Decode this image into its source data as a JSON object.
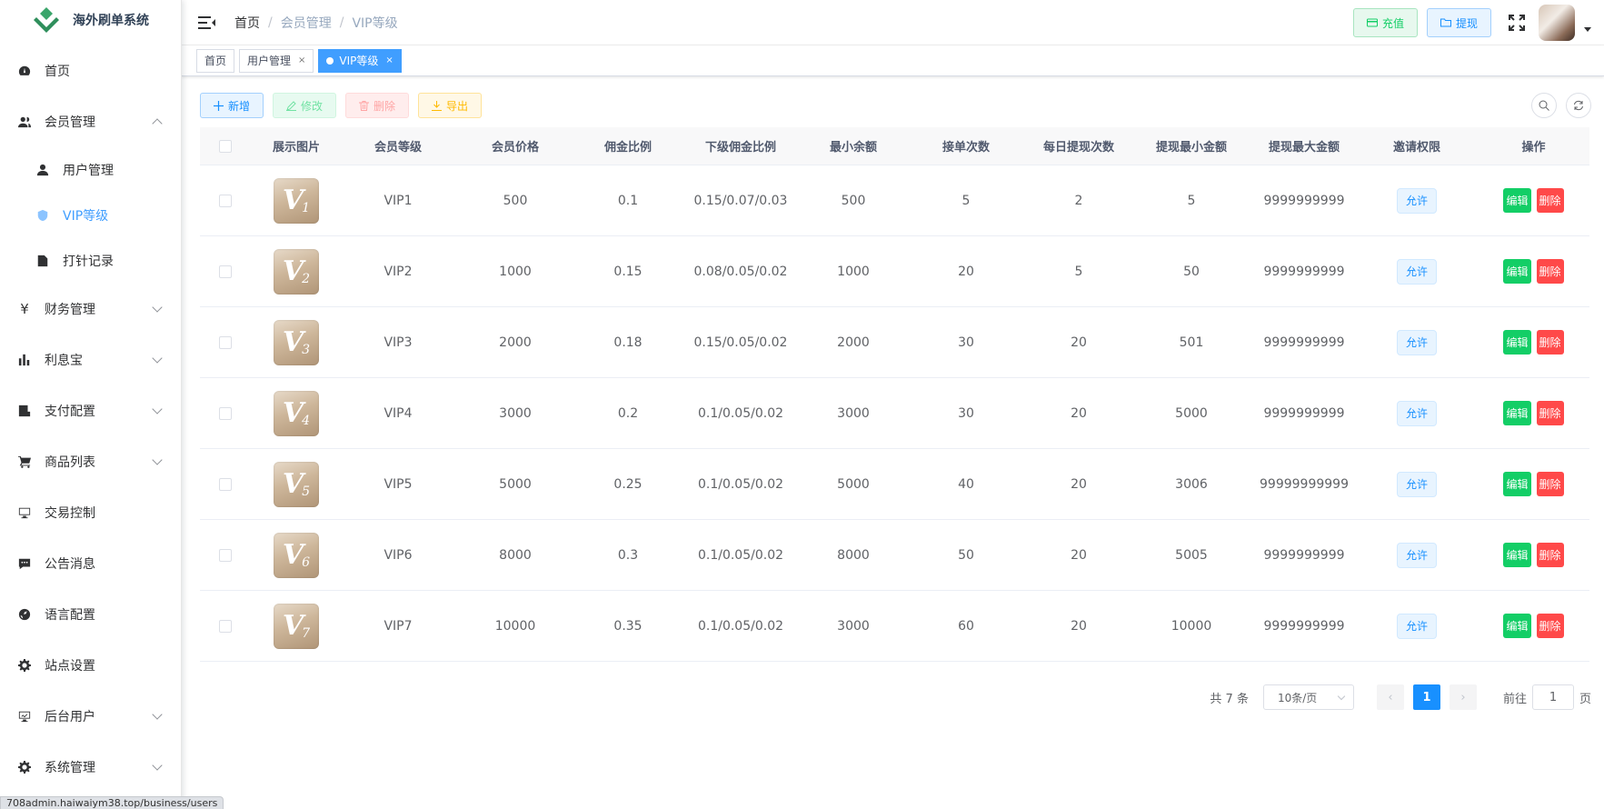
{
  "app": {
    "title": "海外刷单系统"
  },
  "sidebar": {
    "items": [
      {
        "label": "首页",
        "icon": "dashboard-icon"
      },
      {
        "label": "会员管理",
        "icon": "user-group-icon",
        "expanded": true,
        "children": [
          {
            "label": "用户管理",
            "icon": "user-icon"
          },
          {
            "label": "VIP等级",
            "icon": "shield-icon",
            "active": true
          },
          {
            "label": "打针记录",
            "icon": "document-icon"
          }
        ]
      },
      {
        "label": "财务管理",
        "icon": "yen-icon",
        "collapsible": true
      },
      {
        "label": "利息宝",
        "icon": "bar-chart-icon",
        "collapsible": true
      },
      {
        "label": "支付配置",
        "icon": "pay-config-icon",
        "collapsible": true
      },
      {
        "label": "商品列表",
        "icon": "cart-icon",
        "collapsible": true
      },
      {
        "label": "交易控制",
        "icon": "monitor-icon"
      },
      {
        "label": "公告消息",
        "icon": "message-icon"
      },
      {
        "label": "语言配置",
        "icon": "globe-icon"
      },
      {
        "label": "站点设置",
        "icon": "gear-icon"
      },
      {
        "label": "后台用户",
        "icon": "admin-monitor-icon",
        "collapsible": true
      },
      {
        "label": "系统管理",
        "icon": "settings-icon",
        "collapsible": true
      }
    ]
  },
  "header": {
    "breadcrumb": [
      "首页",
      "会员管理",
      "VIP等级"
    ],
    "recharge_label": "充值",
    "withdraw_label": "提现"
  },
  "tags": [
    {
      "label": "首页",
      "closable": false
    },
    {
      "label": "用户管理",
      "closable": true
    },
    {
      "label": "VIP等级",
      "closable": true,
      "active": true
    }
  ],
  "toolbar": {
    "add_label": "新增",
    "edit_label": "修改",
    "delete_label": "删除",
    "export_label": "导出"
  },
  "table": {
    "headers": [
      "展示图片",
      "会员等级",
      "会员价格",
      "佣金比例",
      "下级佣金比例",
      "最小余额",
      "接单次数",
      "每日提现次数",
      "提现最小金额",
      "提现最大金额",
      "邀请权限",
      "操作"
    ],
    "rows": [
      {
        "img": "1",
        "level": "VIP1",
        "price": "500",
        "ratio": "0.1",
        "sub_ratio": "0.15/0.07/0.03",
        "min_balance": "500",
        "orders": "5",
        "daily_withdraw": "2",
        "withdraw_min": "5",
        "withdraw_max": "9999999999",
        "invite": "允许"
      },
      {
        "img": "2",
        "level": "VIP2",
        "price": "1000",
        "ratio": "0.15",
        "sub_ratio": "0.08/0.05/0.02",
        "min_balance": "1000",
        "orders": "20",
        "daily_withdraw": "5",
        "withdraw_min": "50",
        "withdraw_max": "9999999999",
        "invite": "允许"
      },
      {
        "img": "3",
        "level": "VIP3",
        "price": "2000",
        "ratio": "0.18",
        "sub_ratio": "0.15/0.05/0.02",
        "min_balance": "2000",
        "orders": "30",
        "daily_withdraw": "20",
        "withdraw_min": "501",
        "withdraw_max": "9999999999",
        "invite": "允许"
      },
      {
        "img": "4",
        "level": "VIP4",
        "price": "3000",
        "ratio": "0.2",
        "sub_ratio": "0.1/0.05/0.02",
        "min_balance": "3000",
        "orders": "30",
        "daily_withdraw": "20",
        "withdraw_min": "5000",
        "withdraw_max": "9999999999",
        "invite": "允许"
      },
      {
        "img": "5",
        "level": "VIP5",
        "price": "5000",
        "ratio": "0.25",
        "sub_ratio": "0.1/0.05/0.02",
        "min_balance": "5000",
        "orders": "40",
        "daily_withdraw": "20",
        "withdraw_min": "3006",
        "withdraw_max": "99999999999",
        "invite": "允许"
      },
      {
        "img": "6",
        "level": "VIP6",
        "price": "8000",
        "ratio": "0.3",
        "sub_ratio": "0.1/0.05/0.02",
        "min_balance": "8000",
        "orders": "50",
        "daily_withdraw": "20",
        "withdraw_min": "5005",
        "withdraw_max": "9999999999",
        "invite": "允许"
      },
      {
        "img": "7",
        "level": "VIP7",
        "price": "10000",
        "ratio": "0.35",
        "sub_ratio": "0.1/0.05/0.02",
        "min_balance": "3000",
        "orders": "60",
        "daily_withdraw": "20",
        "withdraw_min": "10000",
        "withdraw_max": "9999999999",
        "invite": "允许"
      }
    ],
    "edit_label": "编辑",
    "delete_label": "删除"
  },
  "pagination": {
    "total_text": "共 7 条",
    "page_size": "10条/页",
    "current_page": "1",
    "goto_prefix": "前往",
    "goto_value": "1",
    "goto_suffix": "页"
  },
  "statusbar": {
    "url": "708admin.haiwaiym38.top/business/users"
  },
  "colors": {
    "primary": "#409eff",
    "success": "#13ce66",
    "danger": "#ff4949",
    "warning": "#ffba00"
  }
}
